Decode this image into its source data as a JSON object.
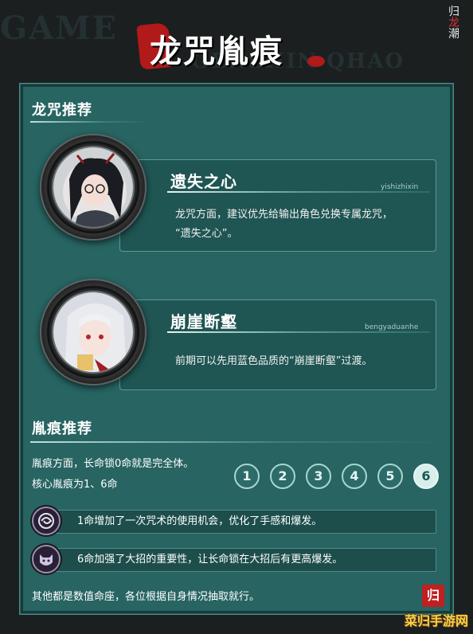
{
  "bg_words": [
    "GAME",
    "GENSHIN QHAO"
  ],
  "corner_logo": {
    "line1": "归",
    "line2": "龙",
    "line3": "潮"
  },
  "title": "龙咒胤痕",
  "section1": {
    "title": "龙咒推荐"
  },
  "cards": [
    {
      "name": "遗失之心",
      "pinyin": "yishizhixin",
      "desc_line1": "龙咒方面，建议优先给输出角色兑换专属龙咒，",
      "desc_line2": "“遗失之心”。"
    },
    {
      "name": "崩崖断壑",
      "pinyin": "bengyaduanhe",
      "desc_line1": "前期可以先用蓝色品质的“崩崖断壑”过渡。",
      "desc_line2": ""
    }
  ],
  "section2": {
    "title": "胤痕推荐",
    "line1": "胤痕方面，长命锁0命就是完全体。",
    "line2": "核心胤痕为1、6命"
  },
  "levels": {
    "items": [
      "1",
      "2",
      "3",
      "4",
      "5",
      "6"
    ],
    "active": "6"
  },
  "rows": [
    {
      "text": "1命增加了一次咒术的使用机会，优化了手感和爆发。",
      "icon": "spiral-sigil-icon"
    },
    {
      "text": "6命加强了大招的重要性，让长命锁在大招后有更高爆发。",
      "icon": "beast-mask-icon"
    }
  ],
  "footer": "其他都是数值命座，各位根据自身情况抽取就行。",
  "badge": "归",
  "watermark": "菜归手游网"
}
